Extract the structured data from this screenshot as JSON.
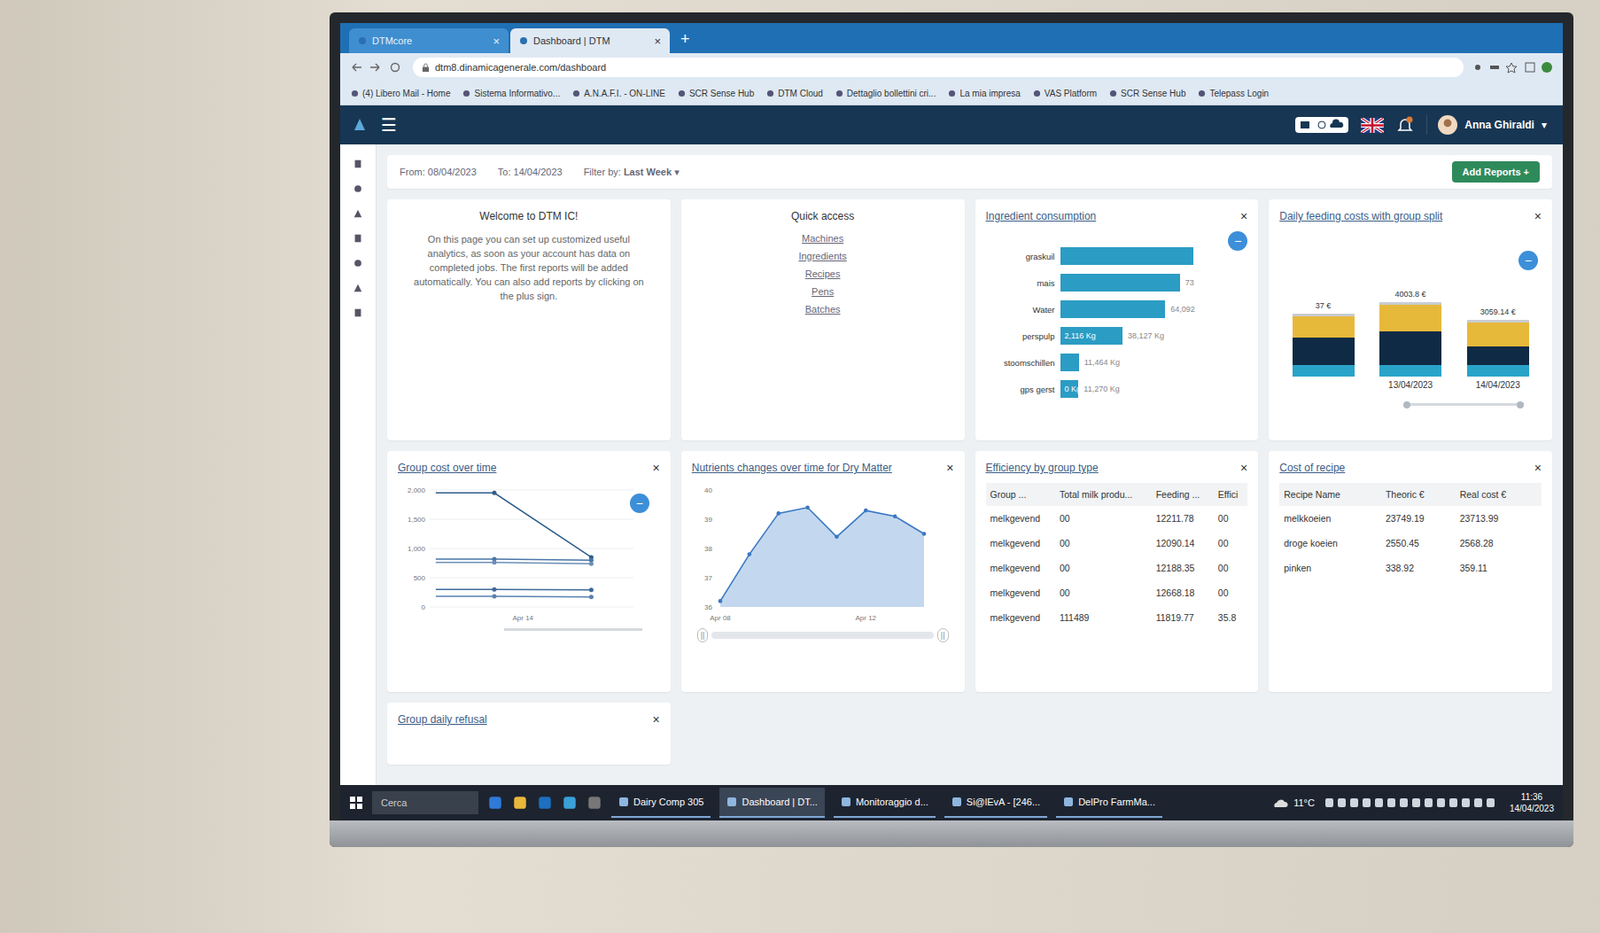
{
  "browser": {
    "tabs": [
      {
        "label": "DTMcore",
        "selected": false,
        "close": "×"
      },
      {
        "label": "Dashboard | DTM",
        "selected": true,
        "close": "×"
      }
    ],
    "new_tab": "+",
    "url": "dtm8.dinamicagenerale.com/dashboard",
    "bookmarks": [
      "(4) Libero Mail - Home",
      "Sistema Informativo...",
      "A.N.A.F.I. - ON-LINE",
      "SCR Sense Hub",
      "DTM Cloud",
      "Dettaglio bollettini cri...",
      "La mia impresa",
      "VAS Platform",
      "SCR Sense Hub",
      "Telepass Login"
    ]
  },
  "app": {
    "menu": "☰",
    "user": "Anna Ghiraldi",
    "caret": "▾"
  },
  "filters": {
    "from_label": "From:",
    "from": "08/04/2023",
    "to_label": "To:",
    "to": "14/04/2023",
    "filter_label": "Filter by:",
    "filter": "Last Week",
    "caret": "▾",
    "add": "Add Reports +"
  },
  "welcome": {
    "title": "Welcome to DTM IC!",
    "text": "On this page you can set up customized useful analytics, as soon as your account has data on completed jobs. The first reports will be added automatically. You can also add reports by clicking on the plus sign."
  },
  "quick_access": {
    "title": "Quick access",
    "links": [
      "Machines",
      "Ingredients",
      "Recipes",
      "Pens",
      "Batches"
    ]
  },
  "ingredients": {
    "title": "Ingredient consumption",
    "close": "×",
    "fab": "−",
    "bars": [
      {
        "name": "graskuil",
        "value": 81000,
        "inner": "",
        "outer": ""
      },
      {
        "name": "mais",
        "value": 73000,
        "inner": "",
        "outer": "73"
      },
      {
        "name": "Water",
        "value": 64092,
        "inner": "",
        "outer": "64,092"
      },
      {
        "name": "perspulp",
        "value": 38127,
        "inner": "2,116 Kg",
        "outer": "38,127 Kg"
      },
      {
        "name": "stoomschillen",
        "value": 11464,
        "inner": "",
        "outer": "11,464 Kg"
      },
      {
        "name": "gps gerst",
        "value": 11270,
        "inner": "0 Kg",
        "outer": "11,270 Kg"
      }
    ]
  },
  "feeding": {
    "title": "Daily feeding costs with group split",
    "close": "×",
    "fab": "−",
    "bars": [
      {
        "total": "37 €",
        "date": ""
      },
      {
        "total": "4003.8 €",
        "date": "13/04/2023"
      },
      {
        "total": "3059.14 €",
        "date": "14/04/2023"
      }
    ],
    "series": [
      {
        "color": "#2aa3c9",
        "values": [
          600,
          620,
          640
        ]
      },
      {
        "color": "#0f2a44",
        "values": [
          1500,
          1800,
          980
        ]
      },
      {
        "color": "#e7b93b",
        "values": [
          1157,
          1430,
          1300
        ]
      },
      {
        "color": "#c9cdd3",
        "values": [
          150,
          153.8,
          139.14
        ]
      }
    ]
  },
  "group_cost": {
    "title": "Group cost over time",
    "close": "×",
    "fab": "−",
    "ticks": [
      "2,000",
      "1,500",
      "1,000",
      "500",
      "0"
    ],
    "x_label": "Apr 14",
    "series": [
      {
        "color": "#2f5d8a",
        "values": [
          1950,
          1950,
          850
        ]
      },
      {
        "color": "#4a77a8",
        "values": [
          820,
          820,
          800
        ]
      },
      {
        "color": "#6b8fb8",
        "values": [
          760,
          760,
          740
        ]
      },
      {
        "color": "#3d6a9a",
        "values": [
          300,
          300,
          290
        ]
      },
      {
        "color": "#5a82b0",
        "values": [
          180,
          180,
          170
        ]
      }
    ]
  },
  "nutrients": {
    "title": "Nutrients changes over time for Dry Matter",
    "close": "×",
    "ticks": [
      "40",
      "39",
      "38",
      "37",
      "36"
    ],
    "x_labels": [
      "Apr 08",
      "Apr 12"
    ],
    "values": [
      36.2,
      37.8,
      39.2,
      39.4,
      38.4,
      39.3,
      39.1,
      38.5
    ],
    "handle": "||"
  },
  "efficiency": {
    "title": "Efficiency by group type",
    "close": "×",
    "columns": [
      "Group ...",
      "Total milk produ...",
      "Feeding ...",
      "Effici"
    ],
    "rows": [
      [
        "melkgevend",
        "00",
        "12211.78",
        "00"
      ],
      [
        "melkgevend",
        "00",
        "12090.14",
        "00"
      ],
      [
        "melkgevend",
        "00",
        "12188.35",
        "00"
      ],
      [
        "melkgevend",
        "00",
        "12668.18",
        "00"
      ],
      [
        "melkgevend",
        "111489",
        "11819.77",
        "35.8"
      ]
    ]
  },
  "recipe_cost": {
    "title": "Cost of recipe",
    "close": "×",
    "columns": [
      "Recipe Name",
      "Theoric €",
      "Real cost €"
    ],
    "rows": [
      [
        "melkkoeien",
        "23749.19",
        "23713.99"
      ],
      [
        "droge koeien",
        "2550.45",
        "2568.28"
      ],
      [
        "pinken",
        "338.92",
        "359.11"
      ]
    ]
  },
  "refusal": {
    "title": "Group daily refusal",
    "close": "×"
  },
  "taskbar": {
    "search": "Cerca",
    "apps": [
      {
        "label": "Dairy Comp 305",
        "selected": false
      },
      {
        "label": "Dashboard | DT...",
        "selected": true
      },
      {
        "label": "Monitoraggio d...",
        "selected": false
      },
      {
        "label": "Si@lEvA - [246...",
        "selected": false
      },
      {
        "label": "DelPro FarmMa...",
        "selected": false
      }
    ],
    "weather": "11°C",
    "time": "11:36",
    "date": "14/04/2023"
  }
}
